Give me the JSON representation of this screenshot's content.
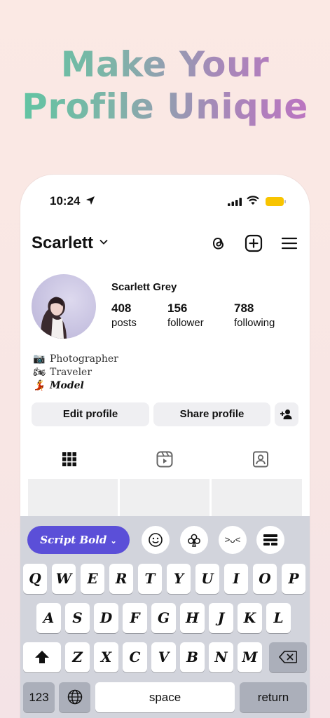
{
  "headline": {
    "line1": "Make Your",
    "line2": "Profile Unique"
  },
  "status_bar": {
    "time": "10:24"
  },
  "profile": {
    "username": "Scarlett",
    "display_name": "Scarlett Grey",
    "stats": [
      {
        "value": "408",
        "label": "posts"
      },
      {
        "value": "156",
        "label": "follower"
      },
      {
        "value": "788",
        "label": "following"
      }
    ],
    "bio": [
      {
        "emoji": "📷",
        "text": "Photographer"
      },
      {
        "emoji": "🏍",
        "text": "Traveler"
      },
      {
        "emoji": "💃",
        "text": "Model"
      }
    ],
    "edit_label": "Edit profile",
    "share_label": "Share profile"
  },
  "keyboard": {
    "font_style_label": "Script Bold",
    "kaomoji_label": ">ᴗ<",
    "row1": [
      "Q",
      "W",
      "E",
      "R",
      "T",
      "Y",
      "U",
      "I",
      "O",
      "P"
    ],
    "row2": [
      "A",
      "S",
      "D",
      "F",
      "G",
      "H",
      "J",
      "K",
      "L"
    ],
    "row3": [
      "Z",
      "X",
      "C",
      "V",
      "B",
      "N",
      "M"
    ],
    "numbers_label": "123",
    "space_label": "space",
    "return_label": "return"
  },
  "colors": {
    "accent_pill": "#5b4fd8",
    "battery": "#f8c400"
  }
}
